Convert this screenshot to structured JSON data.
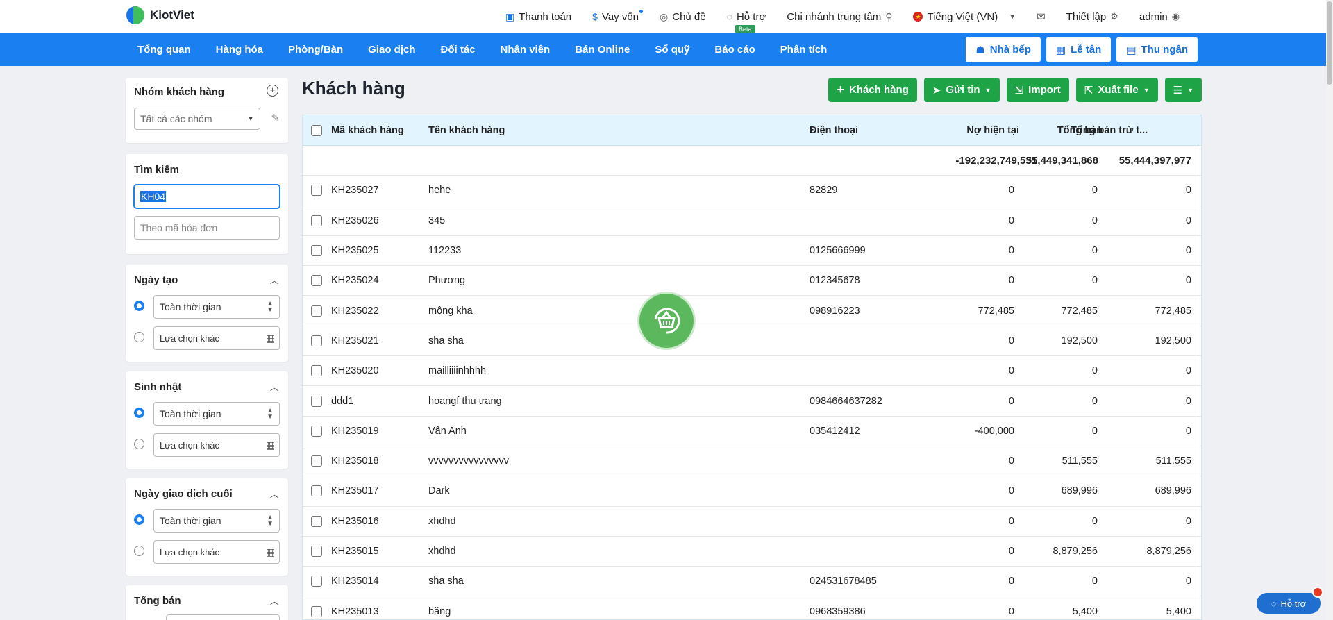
{
  "header": {
    "brand": "KiotViet",
    "links": [
      {
        "label": "Thanh toán",
        "icon": "payment-icon"
      },
      {
        "label": "Vay vốn",
        "icon": "money-bag-icon"
      },
      {
        "label": "Chủ đề",
        "icon": "palette-icon"
      },
      {
        "label": "Hỗ trợ",
        "icon": "chat-icon"
      },
      {
        "label": "Chi nhánh trung tâm",
        "icon": "location-pin-icon"
      },
      {
        "label": "Tiếng Việt (VN)",
        "icon": "vietnam-flag-icon"
      },
      {
        "label": "",
        "icon": "mail-icon"
      },
      {
        "label": "Thiết lập",
        "icon": "gear-icon"
      },
      {
        "label": "admin",
        "icon": "user-icon"
      }
    ],
    "beta_badge": "Beta"
  },
  "nav": {
    "items": [
      "Tổng quan",
      "Hàng hóa",
      "Phòng/Bàn",
      "Giao dịch",
      "Đối tác",
      "Nhân viên",
      "Bán Online",
      "Sổ quỹ",
      "Báo cáo",
      "Phân tích"
    ],
    "buttons": [
      {
        "label": "Nhà bếp",
        "icon": "kitchen-icon"
      },
      {
        "label": "Lễ tân",
        "icon": "calendar-check-icon"
      },
      {
        "label": "Thu ngân",
        "icon": "cashier-icon"
      }
    ]
  },
  "sidebar": {
    "group": {
      "title": "Nhóm khách hàng",
      "select_value": "Tất cả các nhóm"
    },
    "search": {
      "title": "Tìm kiếm",
      "query": "KH04",
      "invoice_placeholder": "Theo mã hóa đơn"
    },
    "created": {
      "title": "Ngày tạo",
      "option_all": "Toàn thời gian",
      "option_custom": "Lựa chọn khác"
    },
    "birthday": {
      "title": "Sinh nhật",
      "option_all": "Toàn thời gian",
      "option_custom": "Lựa chọn khác"
    },
    "last_tx": {
      "title": "Ngày giao dịch cuối",
      "option_all": "Toàn thời gian",
      "option_custom": "Lựa chọn khác"
    },
    "total_sales": {
      "title": "Tổng bán"
    }
  },
  "main": {
    "title": "Khách hàng",
    "actions": [
      {
        "label": "Khách hàng",
        "icon": "plus-icon"
      },
      {
        "label": "Gửi tin",
        "icon": "send-icon"
      },
      {
        "label": "Import",
        "icon": "import-icon"
      },
      {
        "label": "Xuất file",
        "icon": "export-icon"
      }
    ],
    "columns": [
      "Mã khách hàng",
      "Tên khách hàng",
      "Điện thoại",
      "Nợ hiện tại",
      "Tổng bán",
      "Tổng bán trừ t..."
    ],
    "totals": {
      "debt": "-192,232,749,531",
      "sales": "55,449,341,868",
      "net": "55,444,397,977"
    },
    "rows": [
      {
        "code": "KH235027",
        "name": "hehe",
        "phone": "82829",
        "debt": "0",
        "sales": "0",
        "net": "0"
      },
      {
        "code": "KH235026",
        "name": "345",
        "phone": "",
        "debt": "0",
        "sales": "0",
        "net": "0"
      },
      {
        "code": "KH235025",
        "name": "112233",
        "phone": "0125666999",
        "debt": "0",
        "sales": "0",
        "net": "0"
      },
      {
        "code": "KH235024",
        "name": "Phương",
        "phone": "012345678",
        "debt": "0",
        "sales": "0",
        "net": "0"
      },
      {
        "code": "KH235022",
        "name": "mộng kha",
        "phone": "098916223",
        "debt": "772,485",
        "sales": "772,485",
        "net": "772,485"
      },
      {
        "code": "KH235021",
        "name": "sha sha",
        "phone": "",
        "debt": "0",
        "sales": "192,500",
        "net": "192,500"
      },
      {
        "code": "KH235020",
        "name": "mailliiiinhhhh",
        "phone": "",
        "debt": "0",
        "sales": "0",
        "net": "0"
      },
      {
        "code": "ddd1",
        "name": "hoangf thu trang",
        "phone": "0984664637282",
        "debt": "0",
        "sales": "0",
        "net": "0"
      },
      {
        "code": "KH235019",
        "name": "Vân Anh",
        "phone": "035412412",
        "debt": "-400,000",
        "sales": "0",
        "net": "0"
      },
      {
        "code": "KH235018",
        "name": "vvvvvvvvvvvvvvvv",
        "phone": "",
        "debt": "0",
        "sales": "511,555",
        "net": "511,555"
      },
      {
        "code": "KH235017",
        "name": "Dark",
        "phone": "",
        "debt": "0",
        "sales": "689,996",
        "net": "689,996"
      },
      {
        "code": "KH235016",
        "name": "xhdhd",
        "phone": "",
        "debt": "0",
        "sales": "0",
        "net": "0"
      },
      {
        "code": "KH235015",
        "name": "xhdhd",
        "phone": "",
        "debt": "0",
        "sales": "8,879,256",
        "net": "8,879,256"
      },
      {
        "code": "KH235014",
        "name": "sha sha",
        "phone": "024531678485",
        "debt": "0",
        "sales": "0",
        "net": "0"
      },
      {
        "code": "KH235013",
        "name": "băng",
        "phone": "0968359386",
        "debt": "0",
        "sales": "5,400",
        "net": "5,400"
      }
    ]
  },
  "help_widget": {
    "label": "Hỗ trợ"
  },
  "colors": {
    "brand_blue": "#1a7ff0",
    "action_green": "#1ea446",
    "header_row": "#e2f4fd"
  }
}
